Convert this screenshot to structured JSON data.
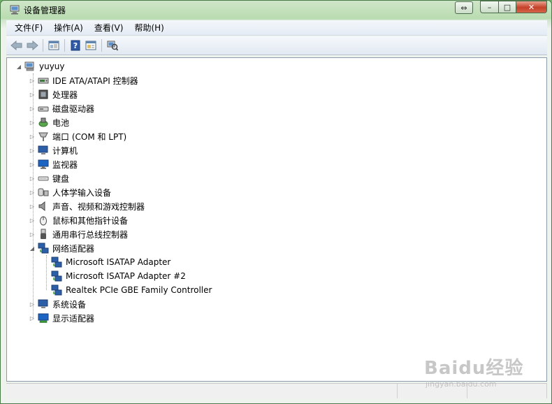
{
  "window": {
    "title": "设备管理器",
    "controls": {
      "switch": "⇔",
      "minimize": "–",
      "maximize": "□",
      "close": "✕"
    }
  },
  "menu": {
    "items": [
      {
        "label": "文件(F)"
      },
      {
        "label": "操作(A)"
      },
      {
        "label": "查看(V)"
      },
      {
        "label": "帮助(H)"
      }
    ]
  },
  "toolbar": {
    "buttons": [
      "back-icon",
      "forward-icon",
      "show-hide-console-tree-icon",
      "help-icon",
      "properties-icon",
      "scan-hardware-icon"
    ]
  },
  "tree": {
    "root": {
      "label": "yuyuy",
      "icon": "computer-icon",
      "expanded": true
    },
    "nodes": [
      {
        "label": "IDE ATA/ATAPI 控制器",
        "icon": "ide-controller-icon",
        "expanded": false
      },
      {
        "label": "处理器",
        "icon": "processor-icon",
        "expanded": false
      },
      {
        "label": "磁盘驱动器",
        "icon": "disk-drive-icon",
        "expanded": false
      },
      {
        "label": "电池",
        "icon": "battery-icon",
        "expanded": false
      },
      {
        "label": "端口 (COM 和 LPT)",
        "icon": "port-icon",
        "expanded": false
      },
      {
        "label": "计算机",
        "icon": "computer-icon",
        "expanded": false
      },
      {
        "label": "监视器",
        "icon": "monitor-icon",
        "expanded": false
      },
      {
        "label": "键盘",
        "icon": "keyboard-icon",
        "expanded": false
      },
      {
        "label": "人体学输入设备",
        "icon": "hid-icon",
        "expanded": false
      },
      {
        "label": "声音、视频和游戏控制器",
        "icon": "speaker-icon",
        "expanded": false
      },
      {
        "label": "鼠标和其他指针设备",
        "icon": "mouse-icon",
        "expanded": false
      },
      {
        "label": "通用串行总线控制器",
        "icon": "usb-icon",
        "expanded": false
      },
      {
        "label": "网络适配器",
        "icon": "network-adapter-icon",
        "expanded": true,
        "children": [
          {
            "label": "Microsoft ISATAP Adapter",
            "icon": "network-adapter-icon"
          },
          {
            "label": "Microsoft ISATAP Adapter #2",
            "icon": "network-adapter-icon"
          },
          {
            "label": "Realtek PCIe GBE Family Controller",
            "icon": "network-adapter-icon"
          }
        ]
      },
      {
        "label": "系统设备",
        "icon": "system-device-icon",
        "expanded": false
      },
      {
        "label": "显示适配器",
        "icon": "display-adapter-icon",
        "expanded": false
      }
    ]
  },
  "watermark": {
    "brand": "Baidu经验",
    "url": "jingyan.baidu.com"
  }
}
